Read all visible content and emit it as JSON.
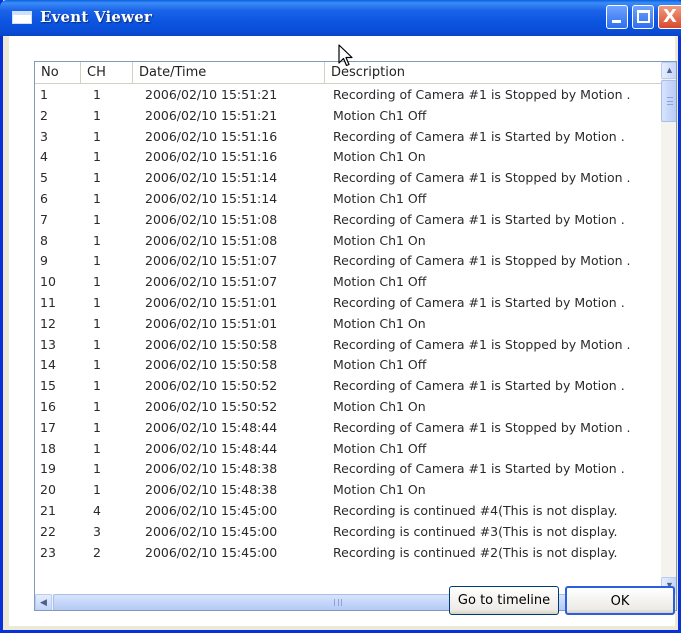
{
  "window": {
    "title": "Event Viewer",
    "icon": "window-app-icon"
  },
  "titlebar_buttons": {
    "minimize_icon": "minimize-icon",
    "maximize_icon": "maximize-icon",
    "close_glyph": "X"
  },
  "table": {
    "columns": [
      "No",
      "CH",
      "Date/Time",
      "Description"
    ],
    "rows": [
      [
        "1",
        "1",
        "2006/02/10 15:51:21",
        "Recording of Camera #1 is Stopped by Motion ."
      ],
      [
        "2",
        "1",
        "2006/02/10 15:51:21",
        "Motion Ch1 Off"
      ],
      [
        "3",
        "1",
        "2006/02/10 15:51:16",
        "Recording of Camera #1 is Started by Motion ."
      ],
      [
        "4",
        "1",
        "2006/02/10 15:51:16",
        "Motion Ch1 On"
      ],
      [
        "5",
        "1",
        "2006/02/10 15:51:14",
        "Recording of Camera #1 is Stopped by Motion ."
      ],
      [
        "6",
        "1",
        "2006/02/10 15:51:14",
        "Motion Ch1 Off"
      ],
      [
        "7",
        "1",
        "2006/02/10 15:51:08",
        "Recording of Camera #1 is Started by Motion ."
      ],
      [
        "8",
        "1",
        "2006/02/10 15:51:08",
        "Motion Ch1 On"
      ],
      [
        "9",
        "1",
        "2006/02/10 15:51:07",
        "Recording of Camera #1 is Stopped by Motion ."
      ],
      [
        "10",
        "1",
        "2006/02/10 15:51:07",
        "Motion Ch1 Off"
      ],
      [
        "11",
        "1",
        "2006/02/10 15:51:01",
        "Recording of Camera #1 is Started by Motion ."
      ],
      [
        "12",
        "1",
        "2006/02/10 15:51:01",
        "Motion Ch1 On"
      ],
      [
        "13",
        "1",
        "2006/02/10 15:50:58",
        "Recording of Camera #1 is Stopped by Motion ."
      ],
      [
        "14",
        "1",
        "2006/02/10 15:50:58",
        "Motion Ch1 Off"
      ],
      [
        "15",
        "1",
        "2006/02/10 15:50:52",
        "Recording of Camera #1 is Started by Motion ."
      ],
      [
        "16",
        "1",
        "2006/02/10 15:50:52",
        "Motion Ch1 On"
      ],
      [
        "17",
        "1",
        "2006/02/10 15:48:44",
        "Recording of Camera #1 is Stopped by Motion ."
      ],
      [
        "18",
        "1",
        "2006/02/10 15:48:44",
        "Motion Ch1 Off"
      ],
      [
        "19",
        "1",
        "2006/02/10 15:48:38",
        "Recording of Camera #1 is Started by Motion ."
      ],
      [
        "20",
        "1",
        "2006/02/10 15:48:38",
        "Motion Ch1 On"
      ],
      [
        "21",
        "4",
        "2006/02/10 15:45:00",
        "Recording is continued #4(This is not display."
      ],
      [
        "22",
        "3",
        "2006/02/10 15:45:00",
        "Recording is continued #3(This is not display."
      ],
      [
        "23",
        "2",
        "2006/02/10 15:45:00",
        "Recording is continued #2(This is not display."
      ]
    ]
  },
  "buttons": {
    "timeline": "Go to timeline",
    "ok": "OK"
  },
  "scrollbar_glyphs": {
    "up": "▲",
    "down": "▼",
    "left": "◀",
    "right": "▶"
  }
}
